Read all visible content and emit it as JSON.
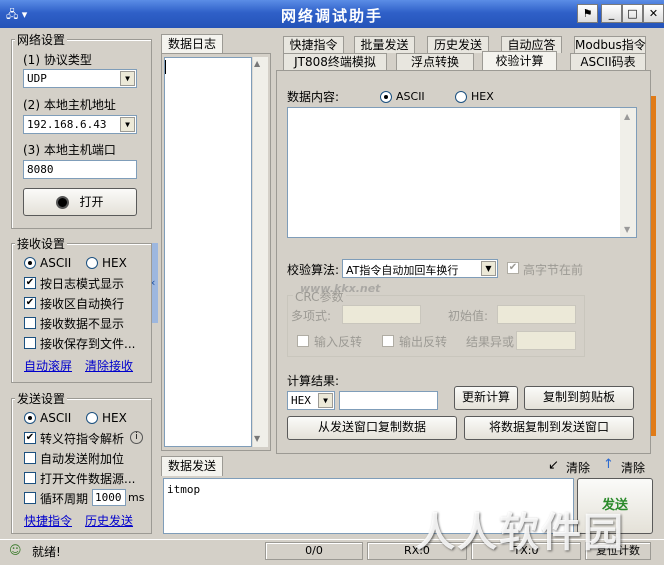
{
  "window": {
    "title": "网络调试助手"
  },
  "network": {
    "group_title": "网络设置",
    "protocol_label": "(1) 协议类型",
    "protocol_value": "UDP",
    "host_label": "(2) 本地主机地址",
    "host_value": "192.168.6.43",
    "port_label": "(3) 本地主机端口",
    "port_value": "8080",
    "open_button": "打开"
  },
  "receive": {
    "group_title": "接收设置",
    "ascii": "ASCII",
    "hex": "HEX",
    "options": [
      "按日志模式显示",
      "接收区自动换行",
      "接收数据不显示",
      "接收保存到文件..."
    ],
    "checked": [
      true,
      true,
      false,
      false
    ],
    "auto_scroll": "自动滚屏",
    "clear_receive": "清除接收"
  },
  "send_settings": {
    "group_title": "发送设置",
    "ascii": "ASCII",
    "hex": "HEX",
    "options": [
      "转义符指令解析",
      "自动发送附加位",
      "打开文件数据源...",
      "循环周期"
    ],
    "checked": [
      true,
      false,
      false,
      false
    ],
    "cycle_value": "1000",
    "cycle_unit": "ms",
    "quick_cmd": "快捷指令",
    "history_send": "历史发送"
  },
  "log": {
    "title": "数据日志"
  },
  "tabs": {
    "row1": [
      "快捷指令",
      "批量发送",
      "历史发送",
      "自动应答",
      "Modbus指令"
    ],
    "row2": [
      "JT808终端模拟",
      "浮点转换",
      "校验计算",
      "ASCII码表"
    ],
    "active": "校验计算"
  },
  "checksum": {
    "data_label": "数据内容:",
    "ascii": "ASCII",
    "hex": "HEX",
    "algo_label": "校验算法:",
    "algo_value": "AT指令自动加回车换行",
    "high_byte_first": "高字节在前",
    "crc_group": "CRC参数",
    "poly_label": "多项式:",
    "init_label": "初始值:",
    "input_reverse": "输入反转",
    "output_reverse": "输出反转",
    "result_xor": "结果异或",
    "result_label": "计算结果:",
    "result_format": "HEX",
    "update_button": "更新计算",
    "copy_clipboard_button": "复制到剪贴板",
    "copy_from_send_button": "从发送窗口复制数据",
    "copy_to_send_button": "将数据复制到发送窗口"
  },
  "send_area": {
    "title": "数据发送",
    "clear1": "清除",
    "clear2": "清除",
    "content": "itmop",
    "send_button": "发送"
  },
  "status": {
    "ready": "就绪!",
    "seg1": "0/0",
    "seg2": "RX:0",
    "seg3": "TX:0",
    "seg4": "复位计数"
  },
  "watermark": {
    "text": "人人软件园",
    "small": "www.kkx.net"
  }
}
